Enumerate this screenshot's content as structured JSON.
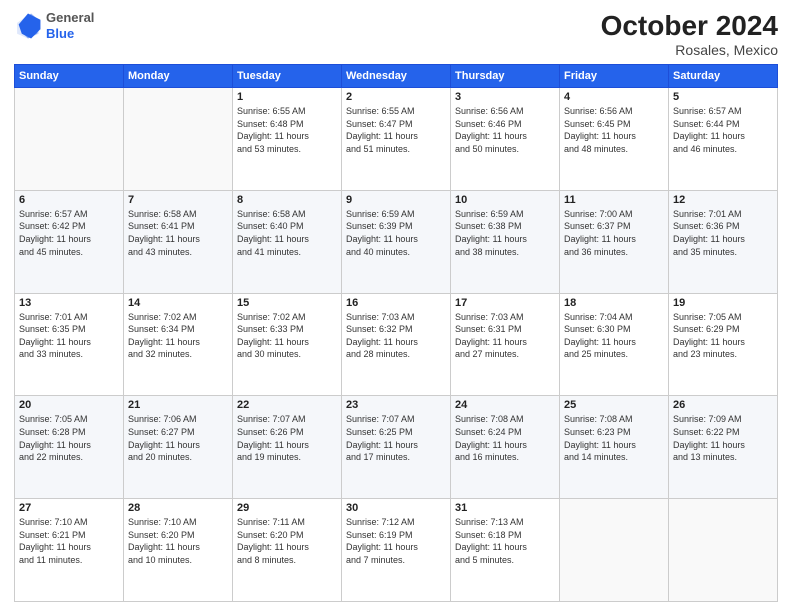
{
  "header": {
    "logo": {
      "general": "General",
      "blue": "Blue"
    },
    "month": "October 2024",
    "location": "Rosales, Mexico"
  },
  "weekdays": [
    "Sunday",
    "Monday",
    "Tuesday",
    "Wednesday",
    "Thursday",
    "Friday",
    "Saturday"
  ],
  "rows": [
    [
      {
        "day": "",
        "info": ""
      },
      {
        "day": "",
        "info": ""
      },
      {
        "day": "1",
        "info": "Sunrise: 6:55 AM\nSunset: 6:48 PM\nDaylight: 11 hours\nand 53 minutes."
      },
      {
        "day": "2",
        "info": "Sunrise: 6:55 AM\nSunset: 6:47 PM\nDaylight: 11 hours\nand 51 minutes."
      },
      {
        "day": "3",
        "info": "Sunrise: 6:56 AM\nSunset: 6:46 PM\nDaylight: 11 hours\nand 50 minutes."
      },
      {
        "day": "4",
        "info": "Sunrise: 6:56 AM\nSunset: 6:45 PM\nDaylight: 11 hours\nand 48 minutes."
      },
      {
        "day": "5",
        "info": "Sunrise: 6:57 AM\nSunset: 6:44 PM\nDaylight: 11 hours\nand 46 minutes."
      }
    ],
    [
      {
        "day": "6",
        "info": "Sunrise: 6:57 AM\nSunset: 6:42 PM\nDaylight: 11 hours\nand 45 minutes."
      },
      {
        "day": "7",
        "info": "Sunrise: 6:58 AM\nSunset: 6:41 PM\nDaylight: 11 hours\nand 43 minutes."
      },
      {
        "day": "8",
        "info": "Sunrise: 6:58 AM\nSunset: 6:40 PM\nDaylight: 11 hours\nand 41 minutes."
      },
      {
        "day": "9",
        "info": "Sunrise: 6:59 AM\nSunset: 6:39 PM\nDaylight: 11 hours\nand 40 minutes."
      },
      {
        "day": "10",
        "info": "Sunrise: 6:59 AM\nSunset: 6:38 PM\nDaylight: 11 hours\nand 38 minutes."
      },
      {
        "day": "11",
        "info": "Sunrise: 7:00 AM\nSunset: 6:37 PM\nDaylight: 11 hours\nand 36 minutes."
      },
      {
        "day": "12",
        "info": "Sunrise: 7:01 AM\nSunset: 6:36 PM\nDaylight: 11 hours\nand 35 minutes."
      }
    ],
    [
      {
        "day": "13",
        "info": "Sunrise: 7:01 AM\nSunset: 6:35 PM\nDaylight: 11 hours\nand 33 minutes."
      },
      {
        "day": "14",
        "info": "Sunrise: 7:02 AM\nSunset: 6:34 PM\nDaylight: 11 hours\nand 32 minutes."
      },
      {
        "day": "15",
        "info": "Sunrise: 7:02 AM\nSunset: 6:33 PM\nDaylight: 11 hours\nand 30 minutes."
      },
      {
        "day": "16",
        "info": "Sunrise: 7:03 AM\nSunset: 6:32 PM\nDaylight: 11 hours\nand 28 minutes."
      },
      {
        "day": "17",
        "info": "Sunrise: 7:03 AM\nSunset: 6:31 PM\nDaylight: 11 hours\nand 27 minutes."
      },
      {
        "day": "18",
        "info": "Sunrise: 7:04 AM\nSunset: 6:30 PM\nDaylight: 11 hours\nand 25 minutes."
      },
      {
        "day": "19",
        "info": "Sunrise: 7:05 AM\nSunset: 6:29 PM\nDaylight: 11 hours\nand 23 minutes."
      }
    ],
    [
      {
        "day": "20",
        "info": "Sunrise: 7:05 AM\nSunset: 6:28 PM\nDaylight: 11 hours\nand 22 minutes."
      },
      {
        "day": "21",
        "info": "Sunrise: 7:06 AM\nSunset: 6:27 PM\nDaylight: 11 hours\nand 20 minutes."
      },
      {
        "day": "22",
        "info": "Sunrise: 7:07 AM\nSunset: 6:26 PM\nDaylight: 11 hours\nand 19 minutes."
      },
      {
        "day": "23",
        "info": "Sunrise: 7:07 AM\nSunset: 6:25 PM\nDaylight: 11 hours\nand 17 minutes."
      },
      {
        "day": "24",
        "info": "Sunrise: 7:08 AM\nSunset: 6:24 PM\nDaylight: 11 hours\nand 16 minutes."
      },
      {
        "day": "25",
        "info": "Sunrise: 7:08 AM\nSunset: 6:23 PM\nDaylight: 11 hours\nand 14 minutes."
      },
      {
        "day": "26",
        "info": "Sunrise: 7:09 AM\nSunset: 6:22 PM\nDaylight: 11 hours\nand 13 minutes."
      }
    ],
    [
      {
        "day": "27",
        "info": "Sunrise: 7:10 AM\nSunset: 6:21 PM\nDaylight: 11 hours\nand 11 minutes."
      },
      {
        "day": "28",
        "info": "Sunrise: 7:10 AM\nSunset: 6:20 PM\nDaylight: 11 hours\nand 10 minutes."
      },
      {
        "day": "29",
        "info": "Sunrise: 7:11 AM\nSunset: 6:20 PM\nDaylight: 11 hours\nand 8 minutes."
      },
      {
        "day": "30",
        "info": "Sunrise: 7:12 AM\nSunset: 6:19 PM\nDaylight: 11 hours\nand 7 minutes."
      },
      {
        "day": "31",
        "info": "Sunrise: 7:13 AM\nSunset: 6:18 PM\nDaylight: 11 hours\nand 5 minutes."
      },
      {
        "day": "",
        "info": ""
      },
      {
        "day": "",
        "info": ""
      }
    ]
  ]
}
